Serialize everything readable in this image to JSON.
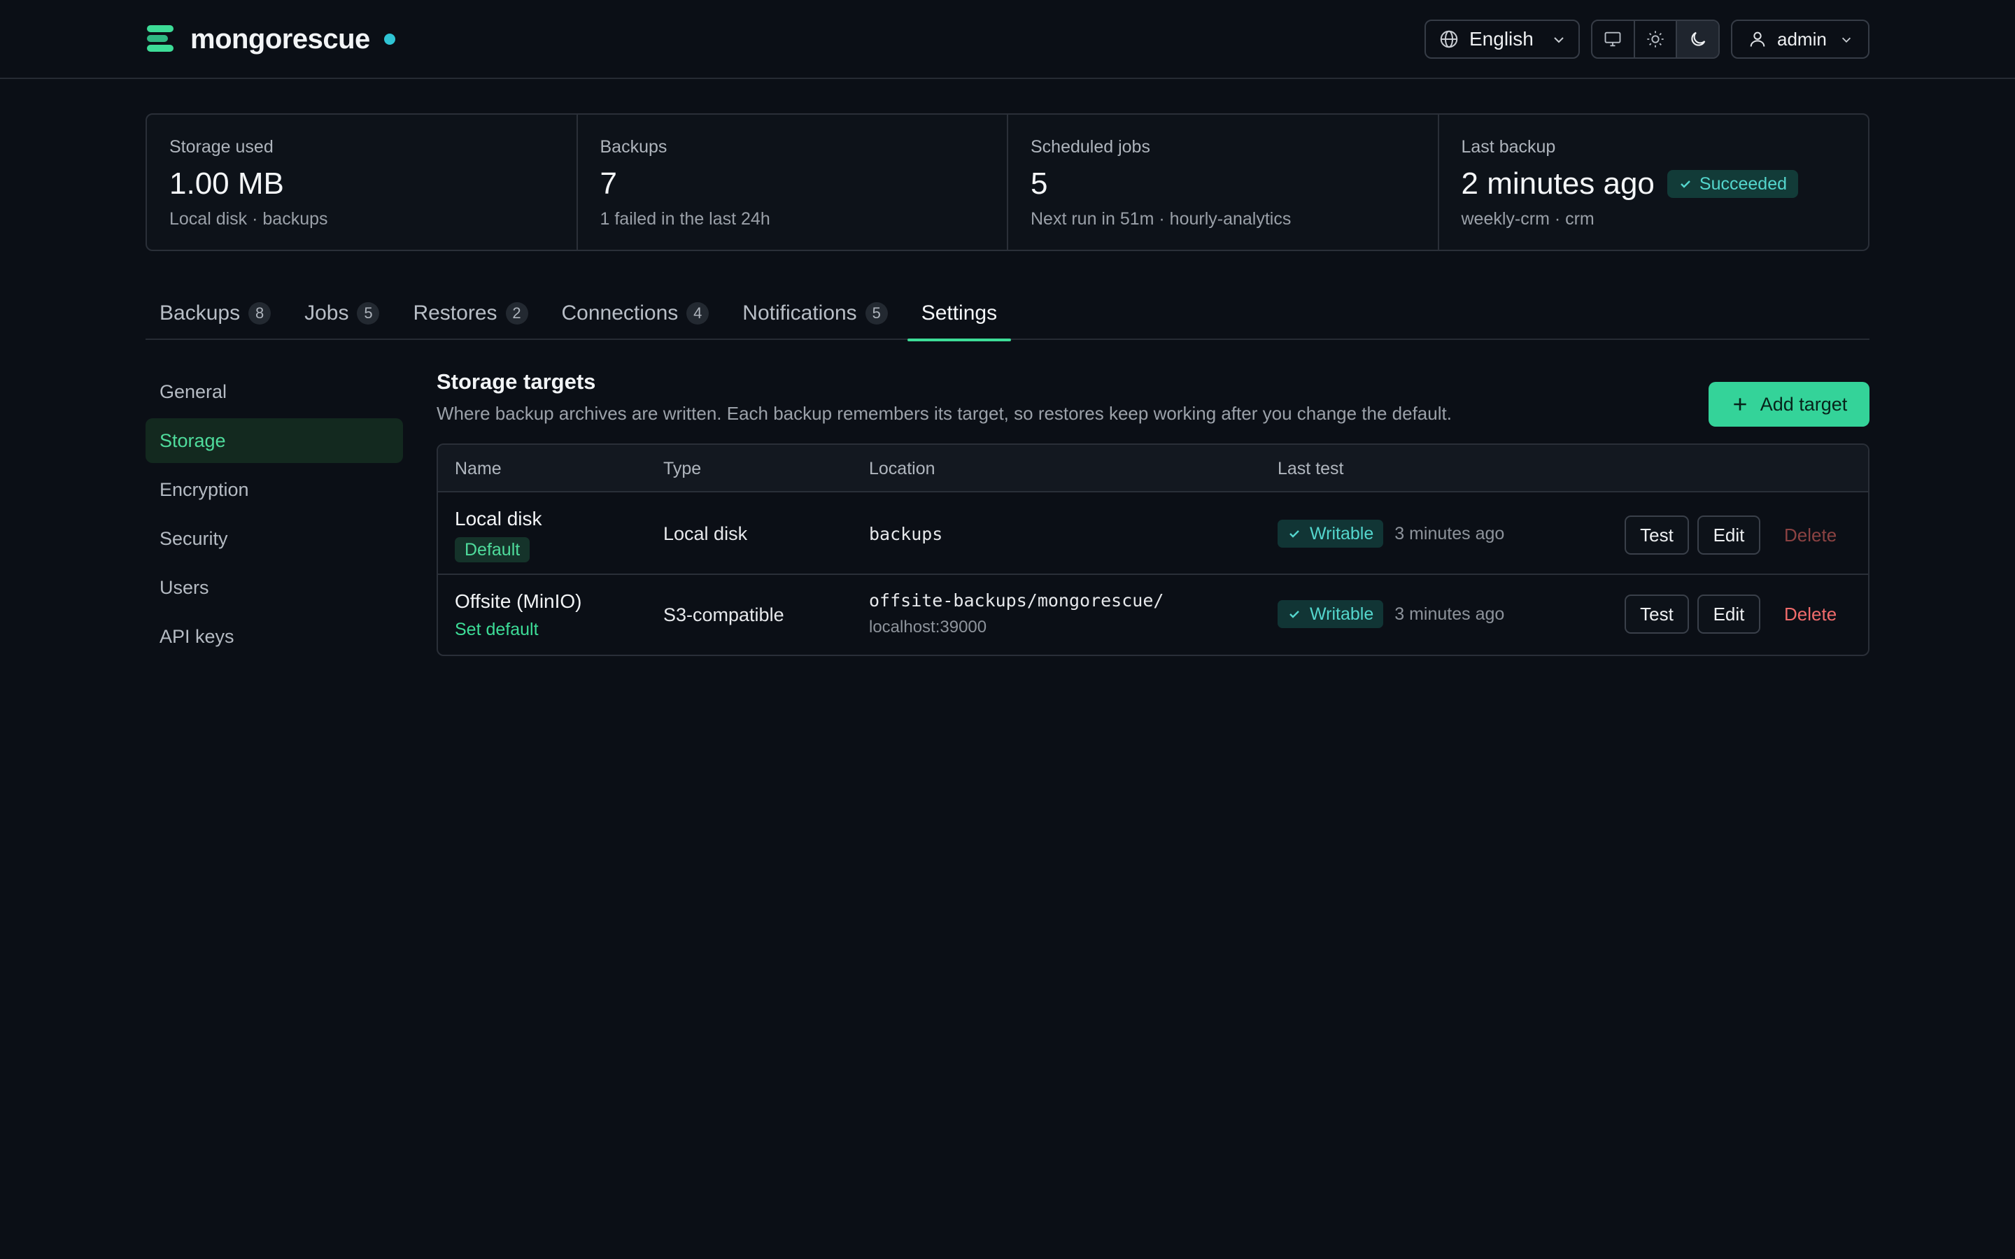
{
  "app": {
    "name": "mongorescue"
  },
  "header": {
    "language": "English",
    "user": "admin",
    "theme_options": [
      "system-icon",
      "sun-icon",
      "moon-icon"
    ],
    "active_theme": "dark"
  },
  "stats": [
    {
      "label": "Storage used",
      "value": "1.00 MB",
      "sub": "Local disk · backups"
    },
    {
      "label": "Backups",
      "value": "7",
      "sub": "1 failed in the last 24h"
    },
    {
      "label": "Scheduled jobs",
      "value": "5",
      "sub": "Next run in 51m · hourly-analytics"
    },
    {
      "label": "Last backup",
      "value": "2 minutes ago",
      "badge": "Succeeded",
      "sub": "weekly-crm · crm"
    }
  ],
  "tabs": [
    {
      "label": "Backups",
      "count": "8"
    },
    {
      "label": "Jobs",
      "count": "5"
    },
    {
      "label": "Restores",
      "count": "2"
    },
    {
      "label": "Connections",
      "count": "4"
    },
    {
      "label": "Notifications",
      "count": "5"
    },
    {
      "label": "Settings",
      "count": null,
      "active": true
    }
  ],
  "sidenav": [
    {
      "label": "General"
    },
    {
      "label": "Storage",
      "active": true
    },
    {
      "label": "Encryption"
    },
    {
      "label": "Security"
    },
    {
      "label": "Users"
    },
    {
      "label": "API keys"
    }
  ],
  "storage": {
    "title": "Storage targets",
    "description": "Where backup archives are written. Each backup remembers its target, so restores keep working after you change the default.",
    "add_label": "Add target",
    "columns": {
      "name": "Name",
      "type": "Type",
      "location": "Location",
      "last_test": "Last test"
    },
    "rows": [
      {
        "name": "Local disk",
        "default_badge": "Default",
        "type": "Local disk",
        "location": "backups",
        "status": "Writable",
        "tested": "3 minutes ago",
        "test_label": "Test",
        "edit_label": "Edit",
        "delete_label": "Delete"
      },
      {
        "name": "Offsite (MinIO)",
        "set_default_label": "Set default",
        "type": "S3-compatible",
        "location": "offsite-backups/mongorescue/",
        "location_sub": "localhost:39000",
        "status": "Writable",
        "tested": "3 minutes ago",
        "test_label": "Test",
        "edit_label": "Edit",
        "delete_label": "Delete"
      }
    ]
  },
  "colors": {
    "accent": "#34d399",
    "danger_enabled": "#f06b6b",
    "danger_disabled": "#8b4242",
    "status_teal": "#54d6cd"
  }
}
